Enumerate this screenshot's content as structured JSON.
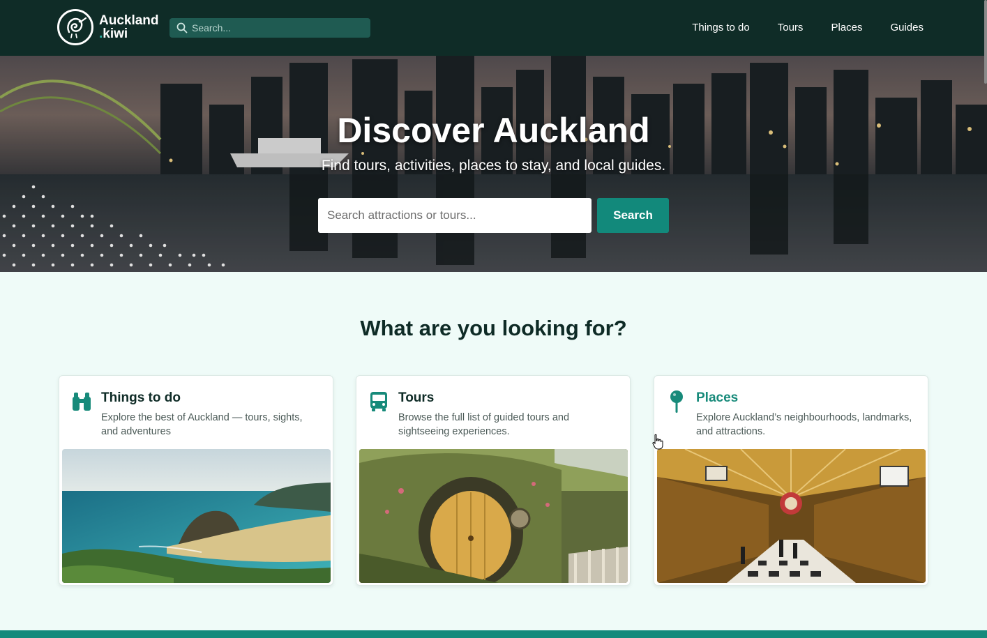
{
  "brand": {
    "line1": "Auckland",
    "dot": ".",
    "line2": "kiwi"
  },
  "nav": {
    "search_placeholder": "Search...",
    "links": [
      "Things to do",
      "Tours",
      "Places",
      "Guides"
    ]
  },
  "hero": {
    "title": "Discover Auckland",
    "subtitle": "Find tours, activities, places to stay, and local guides.",
    "search_placeholder": "Search attractions or tours...",
    "search_button": "Search"
  },
  "section": {
    "title": "What are you looking for?"
  },
  "cards": [
    {
      "title": "Things to do",
      "description": "Explore the best of Auckland — tours, sights, and adventures",
      "icon": "binoculars-icon"
    },
    {
      "title": "Tours",
      "description": "Browse the full list of guided tours and sightseeing experiences.",
      "icon": "bus-icon"
    },
    {
      "title": "Places",
      "description": "Explore Auckland’s neighbourhoods, landmarks, and attractions.",
      "icon": "map-pin-icon"
    }
  ],
  "colors": {
    "nav_bg": "#0f2c27",
    "accent": "#12897b",
    "page_bg": "#effbf8"
  }
}
